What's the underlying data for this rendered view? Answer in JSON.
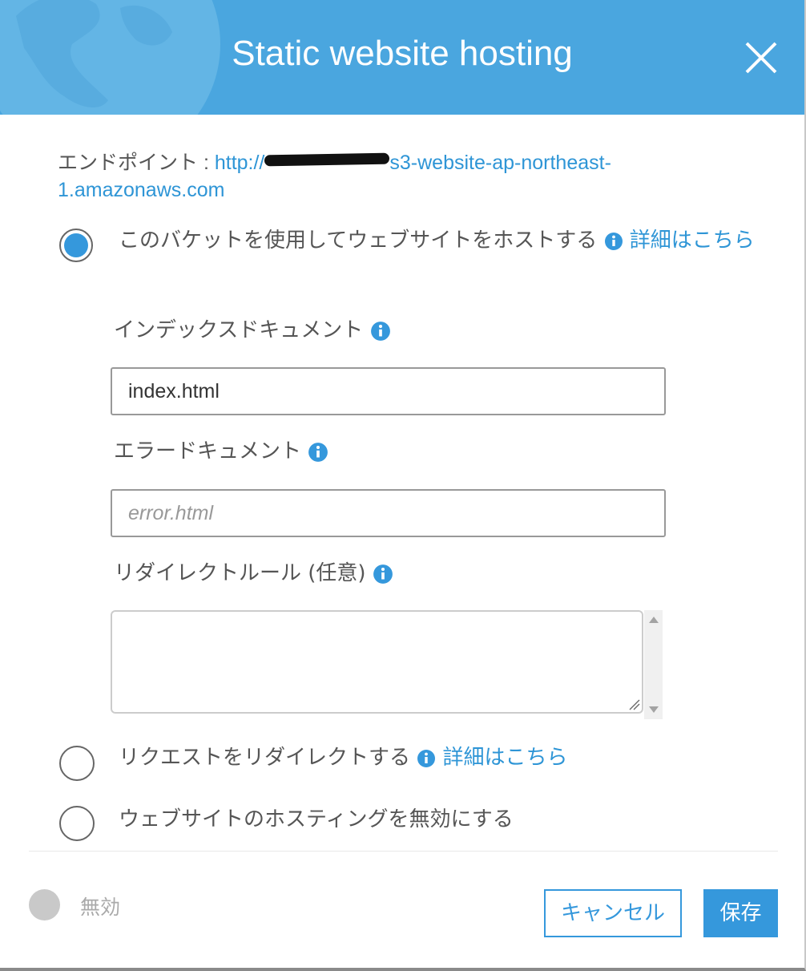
{
  "dialog": {
    "title": "Static website hosting"
  },
  "endpoint": {
    "label": "エンドポイント : ",
    "url_prefix": "http://",
    "url_suffix": "s3-website-ap-northeast-1.amazonaws.com"
  },
  "options": [
    {
      "label": "このバケットを使用してウェブサイトをホストする",
      "link": "詳細はこちら",
      "selected": true
    },
    {
      "label": "リクエストをリダイレクトする",
      "link": "詳細はこちら",
      "selected": false
    },
    {
      "label": "ウェブサイトのホスティングを無効にする",
      "selected": false
    }
  ],
  "fields": {
    "index_label": "インデックスドキュメント",
    "index_value": "index.html",
    "error_label": "エラードキュメント",
    "error_placeholder": "error.html",
    "redirect_label": "リダイレクトルール (任意)",
    "redirect_value": ""
  },
  "footer": {
    "toggle_label": "無効",
    "cancel_label": "キャンセル",
    "save_label": "保存"
  },
  "colors": {
    "header": "#4aa6df",
    "accent": "#3598dc",
    "link": "#2e95d6"
  }
}
